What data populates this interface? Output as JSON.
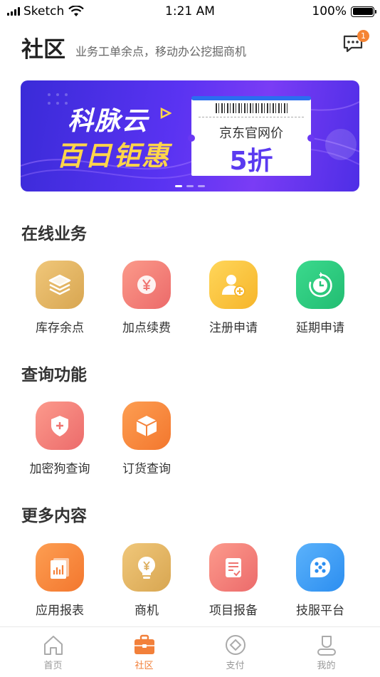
{
  "status_bar": {
    "carrier": "Sketch",
    "time": "1:21 AM",
    "battery": "100%"
  },
  "header": {
    "title": "社区",
    "subtitle": "业务工单余点，移动办公挖掘商机",
    "message_badge": "1",
    "message_icon": "chat-bubble-icon"
  },
  "banner": {
    "line1": "科脉云",
    "line2": "百日钜惠",
    "coupon_text": "京东官网价",
    "coupon_big": "5折",
    "colors": {
      "bg": "#5a33f2",
      "accent": "#ffd54a"
    }
  },
  "sections": {
    "online": {
      "title": "在线业务",
      "items": [
        {
          "label": "库存余点",
          "icon": "layers-icon",
          "color": "#e3b565"
        },
        {
          "label": "加点续费",
          "icon": "yen-coin-icon",
          "color": "#f07a73"
        },
        {
          "label": "注册申请",
          "icon": "user-add-icon",
          "color": "#f9c33c"
        },
        {
          "label": "延期申请",
          "icon": "clock-refresh-icon",
          "color": "#2ec97e"
        }
      ]
    },
    "query": {
      "title": "查询功能",
      "items": [
        {
          "label": "加密狗查询",
          "icon": "shield-plus-icon",
          "color": "#f37e76"
        },
        {
          "label": "订货查询",
          "icon": "box-icon",
          "color": "#f8873e"
        }
      ]
    },
    "more": {
      "title": "更多内容",
      "items": [
        {
          "label": "应用报表",
          "icon": "report-chart-icon",
          "color": "#f8873e"
        },
        {
          "label": "商机",
          "icon": "lightbulb-yen-icon",
          "color": "#e3b565"
        },
        {
          "label": "项目报备",
          "icon": "document-check-icon",
          "color": "#f37e76"
        },
        {
          "label": "技服平台",
          "icon": "service-platform-icon",
          "color": "#3e9ef5"
        }
      ]
    }
  },
  "tabs": [
    {
      "label": "首页",
      "icon": "home-icon",
      "active": false
    },
    {
      "label": "社区",
      "icon": "briefcase-icon",
      "active": true
    },
    {
      "label": "支付",
      "icon": "payment-diamond-icon",
      "active": false
    },
    {
      "label": "我的",
      "icon": "person-icon",
      "active": false
    }
  ],
  "accent_color": "#f2803a"
}
